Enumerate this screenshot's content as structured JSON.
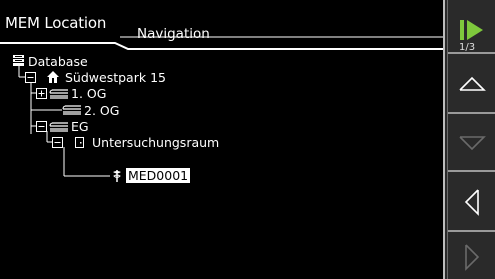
{
  "header": {
    "title": "MEM Location",
    "tab": "Navigation"
  },
  "tree": {
    "root": "Database",
    "site": "Südwestpark 15",
    "floor1": "1. OG",
    "floor2": "2. OG",
    "floor_eg": "EG",
    "room": "Untersuchungsraum",
    "device": "MED0001"
  },
  "softkeys": {
    "page_indicator": "1/3",
    "keys": [
      "next-page-icon",
      "up-arrow-icon",
      "down-arrow-icon",
      "left-arrow-icon",
      "right-arrow-icon"
    ]
  },
  "colors": {
    "accent_green": "#7ec83c",
    "softkey_bg": "#2a2a2a"
  }
}
